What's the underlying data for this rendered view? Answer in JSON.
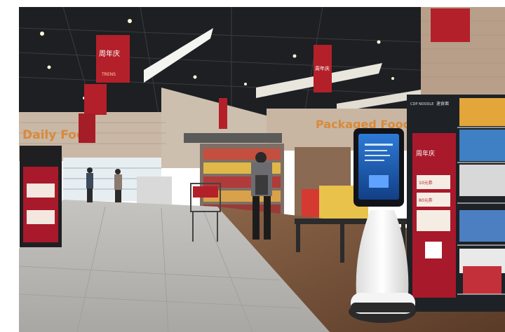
{
  "signs": {
    "daily_food": "Daily Food",
    "packaged_food": "Packaged Food",
    "banner_text": "周年庆",
    "banner_brand": "TRENS",
    "cdp_noodle": "CDP NOODLE",
    "noodle_cn": "速食面",
    "kiosk_price_1": "10元券",
    "kiosk_price_2": "80元券"
  },
  "colors": {
    "wall": "#c9b8a6",
    "ceiling": "#1d1f22",
    "floor_tile": "#b7b5b1",
    "wood_floor": "#6b4a35",
    "banner_red": "#b3202a",
    "sign_orange": "#d98a3a",
    "robot_screen": "#1e5fb8",
    "robot_body": "#f2f2f2"
  }
}
